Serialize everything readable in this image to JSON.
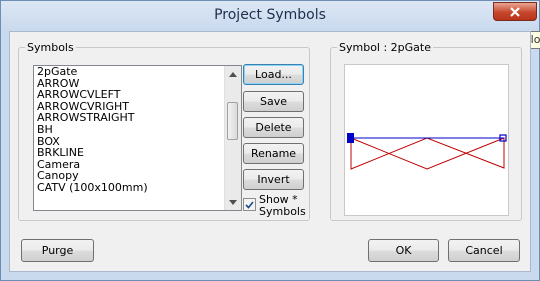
{
  "window": {
    "title": "Project Symbols",
    "close_tooltip": "Clo"
  },
  "symbols_group": {
    "label": "Symbols",
    "items": [
      "2pGate",
      "ARROW",
      "ARROWCVLEFT",
      "ARROWCVRIGHT",
      "ARROWSTRAIGHT",
      "BH",
      "BOX",
      "BRKLINE",
      "Camera",
      "Canopy",
      "CATV (100x100mm)"
    ]
  },
  "buttons": {
    "load": "Load...",
    "save": "Save",
    "delete": "Delete",
    "rename": "Rename",
    "invert": "Invert",
    "purge": "Purge",
    "ok": "OK",
    "cancel": "Cancel"
  },
  "show_symbols": {
    "label": "Show * Symbols",
    "checked": true
  },
  "preview_group": {
    "label": "Symbol : 2pGate"
  },
  "colors": {
    "symbol_outline": "#c00000",
    "symbol_axis": "#0000c8"
  }
}
